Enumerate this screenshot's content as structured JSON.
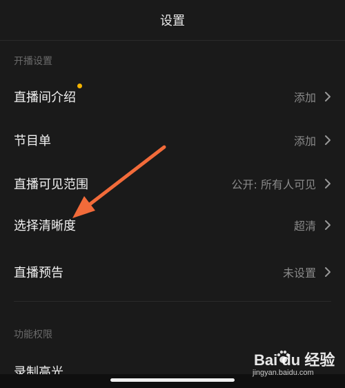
{
  "header": {
    "title": "设置"
  },
  "sections": {
    "broadcast": {
      "label": "开播设置",
      "rows": [
        {
          "label": "直播间介绍",
          "value": "添加",
          "has_dot": true
        },
        {
          "label": "节目单",
          "value": "添加"
        },
        {
          "label": "直播可见范围",
          "value": "公开: 所有人可见"
        },
        {
          "label": "选择清晰度",
          "value": "超清"
        },
        {
          "label": "直播预告",
          "value": "未设置"
        }
      ]
    },
    "permissions": {
      "label": "功能权限",
      "rows": [
        {
          "label": "录制高光"
        }
      ]
    }
  },
  "annotation": {
    "type": "arrow",
    "color": "#f26b3a",
    "points_to": "选择清晰度"
  },
  "colors": {
    "background": "#1a1a1a",
    "dot": "#f5b400",
    "muted_text": "#8a8a8a"
  },
  "watermark": {
    "brand": "Bai du 经验",
    "url": "jingyan.baidu.com"
  }
}
